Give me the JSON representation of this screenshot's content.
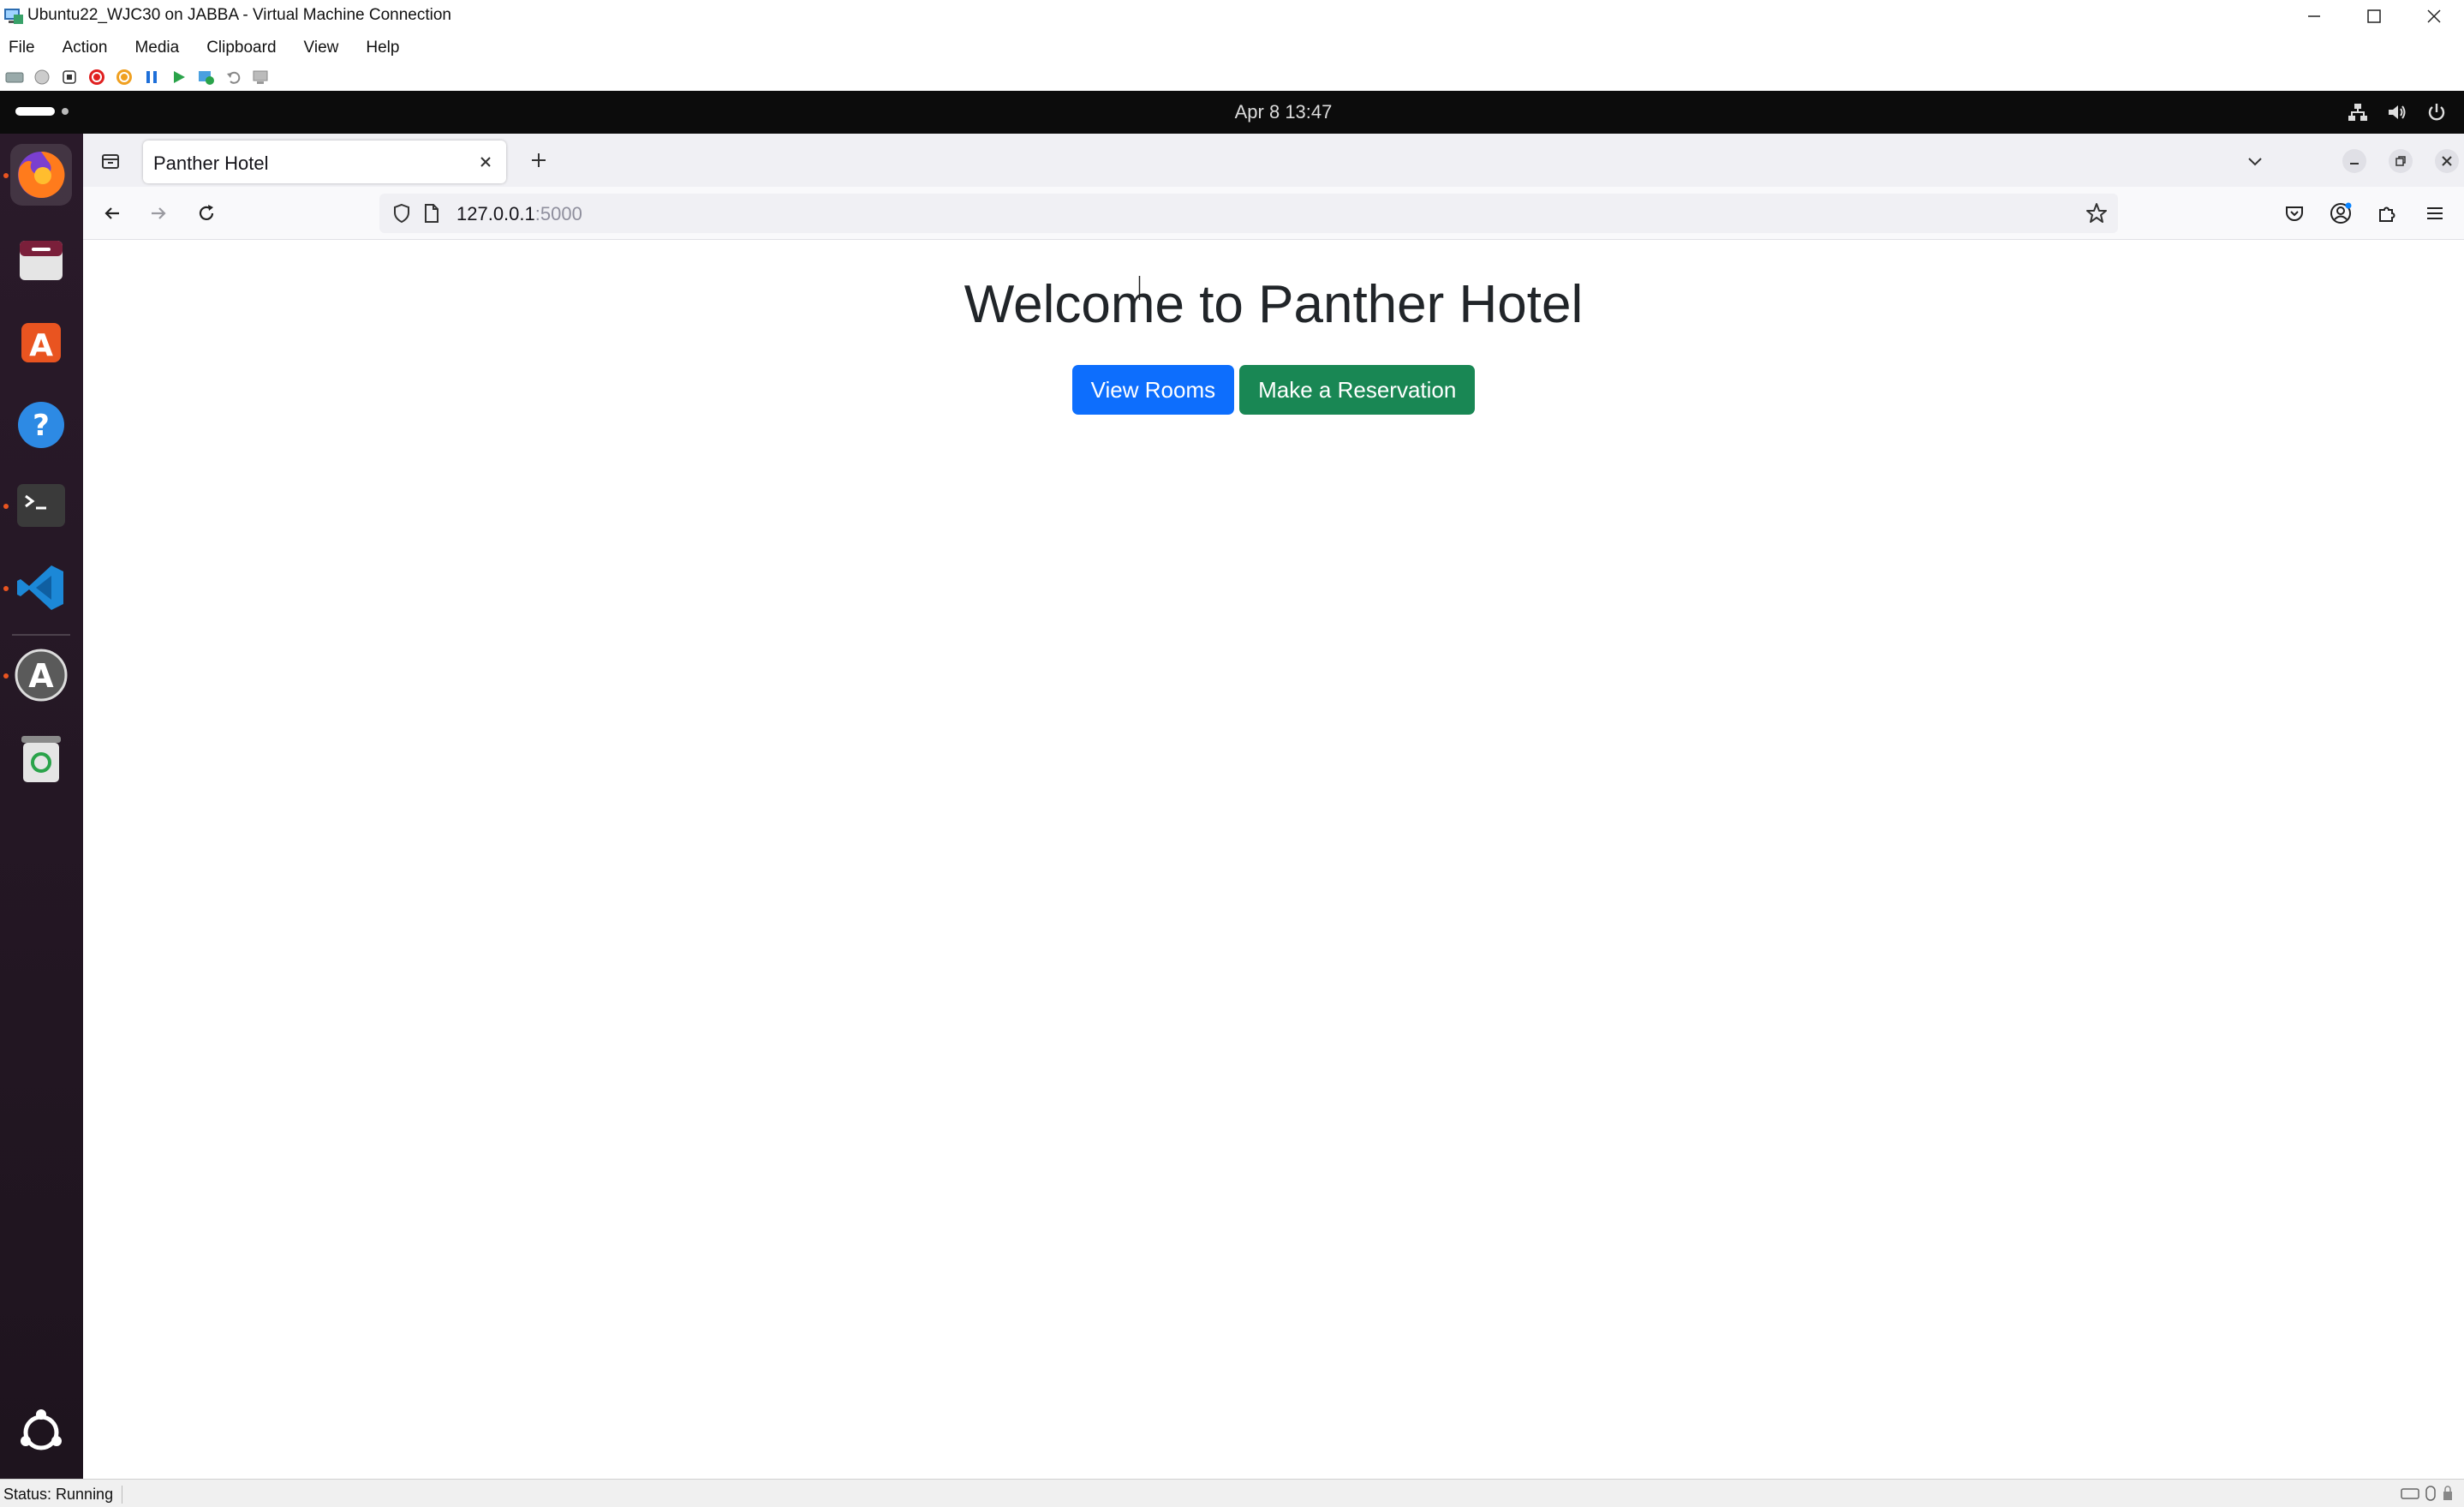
{
  "host_window": {
    "title": "Ubuntu22_WJC30 on JABBA - Virtual Machine Connection",
    "menu": [
      "File",
      "Action",
      "Media",
      "Clipboard",
      "View",
      "Help"
    ],
    "status": "Status: Running"
  },
  "ubuntu": {
    "clock": "Apr 8  13:47",
    "dock": [
      "firefox-icon",
      "files-icon",
      "app-center-icon",
      "help-icon",
      "terminal-icon",
      "vscode-icon",
      "software-updater-icon",
      "trash-icon",
      "show-apps-icon"
    ]
  },
  "browser": {
    "tab_title": "Panther Hotel",
    "url_host": "127.0.0.1",
    "url_port": ":5000"
  },
  "page": {
    "heading": "Welcome to Panther Hotel",
    "view_rooms_label": "View Rooms",
    "reservation_label": "Make a Reservation"
  },
  "colors": {
    "primary_button": "#0d6efd",
    "success_button": "#198754",
    "ubuntu_topbar": "#0c0c0c",
    "dock": "#2a1a2a"
  }
}
